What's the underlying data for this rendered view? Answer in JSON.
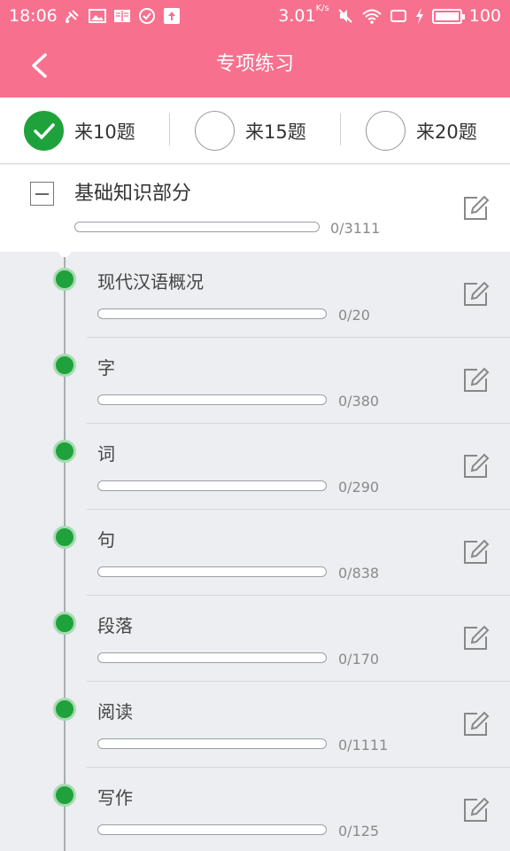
{
  "status_bar": {
    "time": "18:06",
    "net_speed": "3.01",
    "net_speed_unit": "K/s",
    "battery": "100"
  },
  "header": {
    "title": "专项练习",
    "color": "#f7718f"
  },
  "count_options": [
    {
      "label": "来10题",
      "selected": true
    },
    {
      "label": "来15题",
      "selected": false
    },
    {
      "label": "来20题",
      "selected": false
    }
  ],
  "section": {
    "title": "基础知识部分",
    "progress": "0/3111",
    "progress_fraction": 0
  },
  "items": [
    {
      "title": "现代汉语概况",
      "progress": "0/20",
      "progress_fraction": 0
    },
    {
      "title": "字",
      "progress": "0/380",
      "progress_fraction": 0
    },
    {
      "title": "词",
      "progress": "0/290",
      "progress_fraction": 0
    },
    {
      "title": "句",
      "progress": "0/838",
      "progress_fraction": 0
    },
    {
      "title": "段落",
      "progress": "0/170",
      "progress_fraction": 0
    },
    {
      "title": "阅读",
      "progress": "0/1111",
      "progress_fraction": 0
    },
    {
      "title": "写作",
      "progress": "0/125",
      "progress_fraction": 0
    }
  ],
  "colors": {
    "accent_green": "#1fa23c",
    "background": "#eceef2"
  },
  "icons": {
    "back": "chevron-left-icon",
    "edit": "edit-pencil-icon",
    "collapse": "collapse-minus-icon",
    "check": "checkmark-icon"
  }
}
